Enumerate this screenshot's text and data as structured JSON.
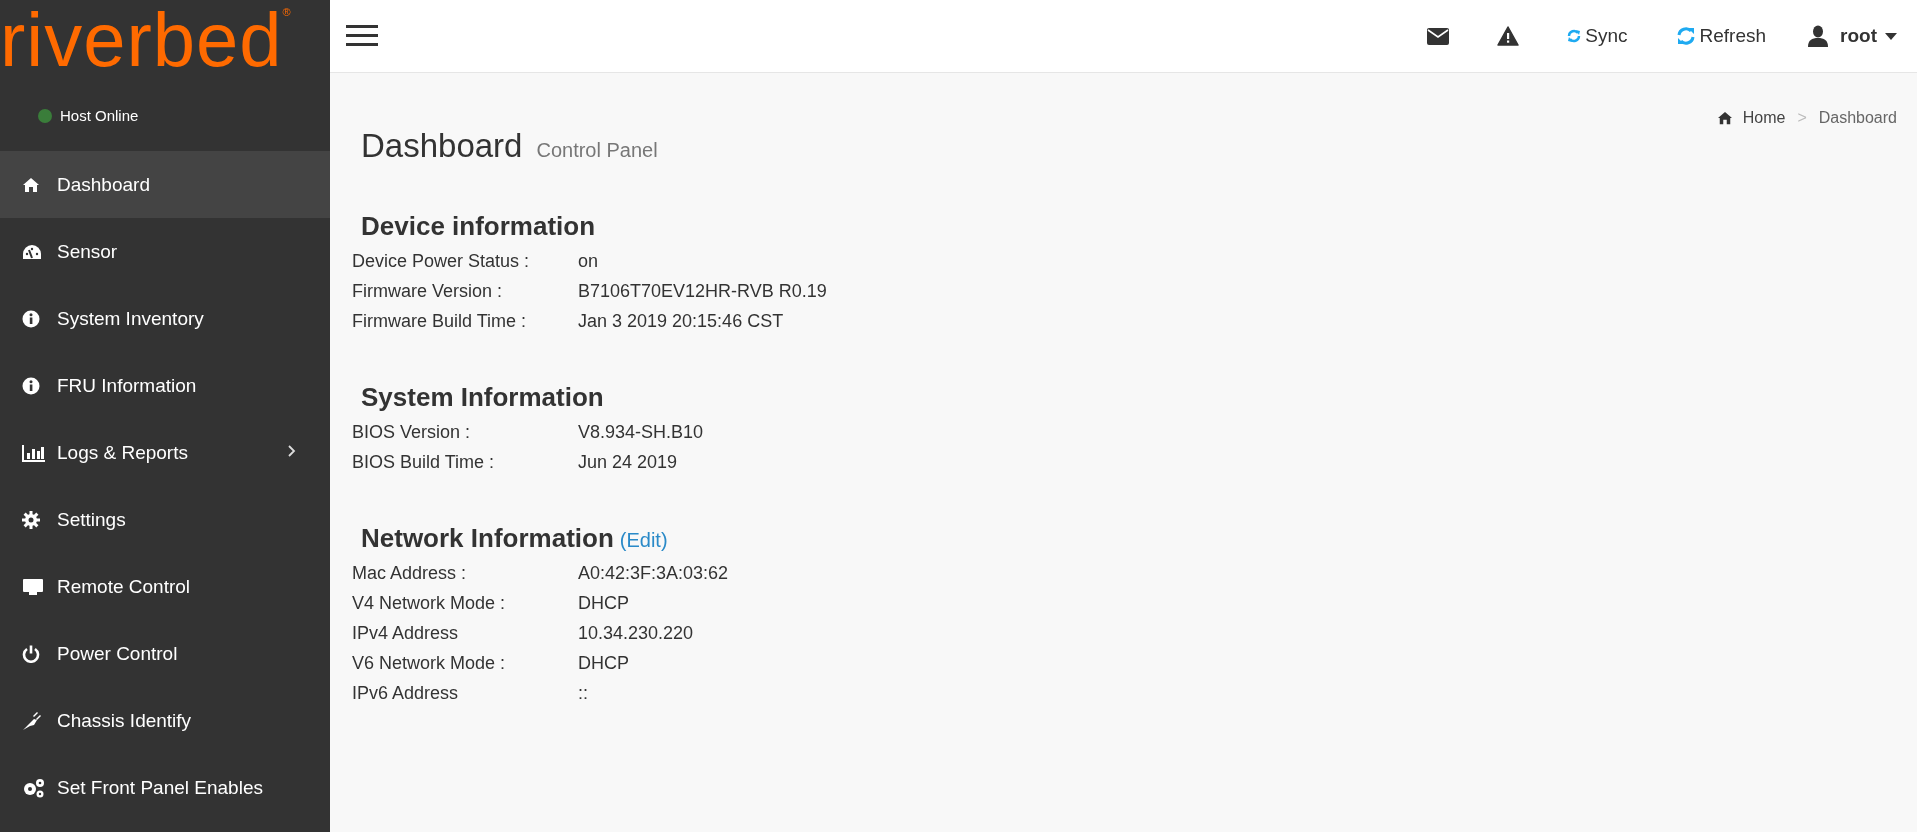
{
  "logo": {
    "text": "riverbed",
    "mark": "®"
  },
  "host_status": {
    "label": "Host Online",
    "color": "#3a7d3a"
  },
  "sidebar": {
    "items": [
      {
        "label": "Dashboard",
        "selected": true,
        "has_submenu": false
      },
      {
        "label": "Sensor",
        "selected": false,
        "has_submenu": false
      },
      {
        "label": "System Inventory",
        "selected": false,
        "has_submenu": false
      },
      {
        "label": "FRU Information",
        "selected": false,
        "has_submenu": false
      },
      {
        "label": "Logs & Reports",
        "selected": false,
        "has_submenu": true
      },
      {
        "label": "Settings",
        "selected": false,
        "has_submenu": false
      },
      {
        "label": "Remote Control",
        "selected": false,
        "has_submenu": false
      },
      {
        "label": "Power Control",
        "selected": false,
        "has_submenu": false
      },
      {
        "label": "Chassis Identify",
        "selected": false,
        "has_submenu": false
      },
      {
        "label": "Set Front Panel Enables",
        "selected": false,
        "has_submenu": false
      }
    ]
  },
  "topbar": {
    "sync": "Sync",
    "refresh": "Refresh",
    "user": "root"
  },
  "breadcrumb": {
    "home": "Home",
    "separator": ">",
    "current": "Dashboard"
  },
  "page": {
    "title": "Dashboard",
    "subtitle": "Control Panel"
  },
  "sections": [
    {
      "heading": "Device information",
      "rows": [
        {
          "label": "Device Power Status :",
          "value": "on"
        },
        {
          "label": "Firmware Version :",
          "value": "B7106T70EV12HR-RVB R0.19"
        },
        {
          "label": "Firmware Build Time :",
          "value": "Jan 3 2019 20:15:46 CST"
        }
      ]
    },
    {
      "heading": "System Information",
      "rows": [
        {
          "label": "BIOS Version :",
          "value": "V8.934-SH.B10"
        },
        {
          "label": "BIOS Build Time :",
          "value": "Jun 24 2019"
        }
      ]
    },
    {
      "heading": "Network Information",
      "link": "(Edit)",
      "rows": [
        {
          "label": "Mac Address :",
          "value": "A0:42:3F:3A:03:62"
        },
        {
          "label": "V4 Network Mode :",
          "value": "DHCP"
        },
        {
          "label": "IPv4 Address",
          "value": "10.34.230.220"
        },
        {
          "label": "V6 Network Mode :",
          "value": "DHCP"
        },
        {
          "label": "IPv6 Address",
          "value": "::"
        }
      ]
    }
  ]
}
